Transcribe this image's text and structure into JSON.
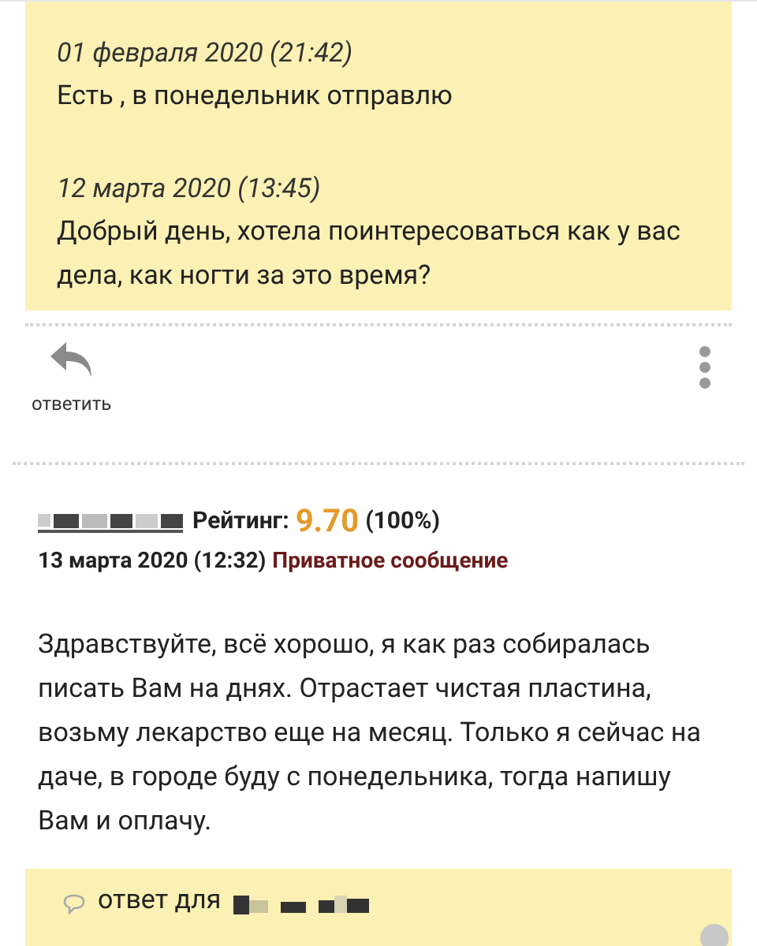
{
  "thread": {
    "messages": [
      {
        "date": "01 февраля 2020 (21:42)",
        "text": "Есть , в понедельник отправлю"
      },
      {
        "date": "12 марта 2020 (13:45)",
        "text": "Добрый день, хотела поинтересоваться как у вас дела, как ногти за это время?"
      }
    ]
  },
  "actions": {
    "reply": "ответить"
  },
  "post": {
    "rating_label": "Рейтинг:",
    "rating": "9.70",
    "rating_percent": "(100%)",
    "date": "13 марта 2020 (12:32)",
    "kind_label": "Приватное сообщение",
    "body": "Здравствуйте, всё хорошо, я как раз собиралась писать Вам на днях. Отрастает чистая пластина, возьму лекарство еще на месяц. Только я сейчас на даче, в городе буду с понедельника, тогда напишу Вам и оплачу."
  },
  "reply_box": {
    "label": "ответ для"
  }
}
